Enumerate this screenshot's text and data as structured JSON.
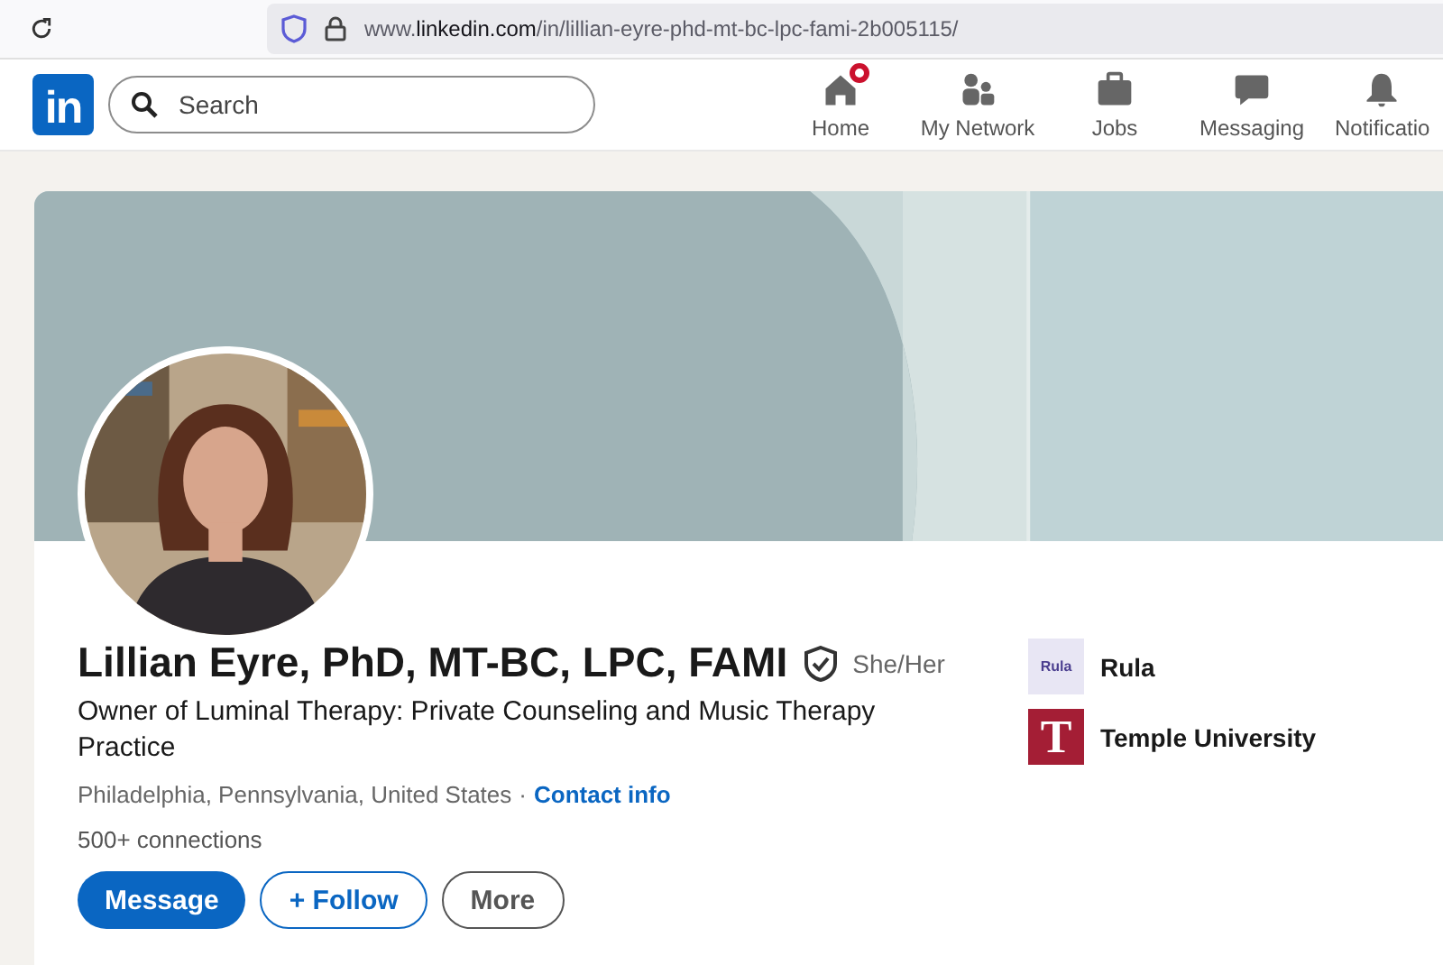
{
  "browser": {
    "url": "www.**linkedin.com**/in/lillian-eyre-phd-mt-bc-lpc-fami-2b005115/"
  },
  "nav": {
    "logo": "in",
    "search": {
      "placeholder": "Search"
    },
    "items": [
      {
        "label": "Home",
        "kind": "home",
        "badge": true
      },
      {
        "label": "My Network",
        "kind": "network",
        "badge": false
      },
      {
        "label": "Jobs",
        "kind": "jobs",
        "badge": false
      },
      {
        "label": "Messaging",
        "kind": "messaging",
        "badge": false
      },
      {
        "label": "Notificatio",
        "kind": "bell",
        "badge": false
      }
    ]
  },
  "profile": {
    "name": "Lillian Eyre, PhD, MT-BC, LPC, FAMI",
    "verified": true,
    "pronouns": "She/Her",
    "headline": "Owner of Luminal Therapy: Private Counseling and Music Therapy Practice",
    "location": "Philadelphia, Pennsylvania, United States",
    "separator": "·",
    "contact_link": "Contact info",
    "connections": "500+ connections",
    "buttons": [
      {
        "label": "Message",
        "kind": "primary"
      },
      {
        "label": "+ Follow",
        "kind": "outline"
      },
      {
        "label": "More",
        "kind": "secondary"
      }
    ],
    "organizations": [
      {
        "name": "Rula",
        "logo_text": "Rula",
        "kind": "rula"
      },
      {
        "name": "Temple University",
        "logo_text": "T",
        "kind": "temple"
      }
    ]
  }
}
